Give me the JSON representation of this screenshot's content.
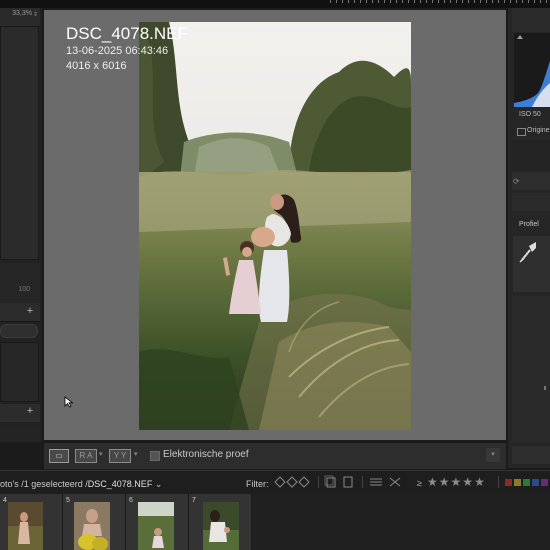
{
  "left_panel": {
    "zoom_readout": "33,3%",
    "zoom_arrows": "⇕",
    "slider_value": "100",
    "add_buttons": [
      "+",
      "+"
    ]
  },
  "photo_info": {
    "filename": "DSC_4078.NEF",
    "datetime": "13-06-2025 06:43:46",
    "dimensions": "4016 x 6016"
  },
  "toolbar": {
    "view_loupe": "▭",
    "view_compare": "R A",
    "view_survey": "Y Y",
    "softproof_label": "Elektronische proef",
    "dropdown_arrow": "▾"
  },
  "right_panel": {
    "iso_label": "ISO 50",
    "original_label": "Origine",
    "profile_label": "Profiel"
  },
  "filmstrip_bar": {
    "breadcrumb_prefix": "oto's /1 geselecteerd /",
    "breadcrumb_file": "DSC_4078.NEF",
    "breadcrumb_arrow": "⌄",
    "filter_label": "Filter:",
    "stars_prefix": "≥",
    "stars": [
      "★",
      "★",
      "★",
      "★",
      "★"
    ],
    "color_labels": [
      "#8a2a2a",
      "#8a7a2a",
      "#2a7a3a",
      "#2a4a8a",
      "#6a2a7a"
    ]
  },
  "filmstrip": {
    "numbers": [
      "4",
      "5",
      "6",
      "7"
    ]
  },
  "colors": {
    "canvas_bg": "#6b6b6b",
    "panel_bg": "#262626",
    "histogram_blue": "#3d7fd6"
  }
}
